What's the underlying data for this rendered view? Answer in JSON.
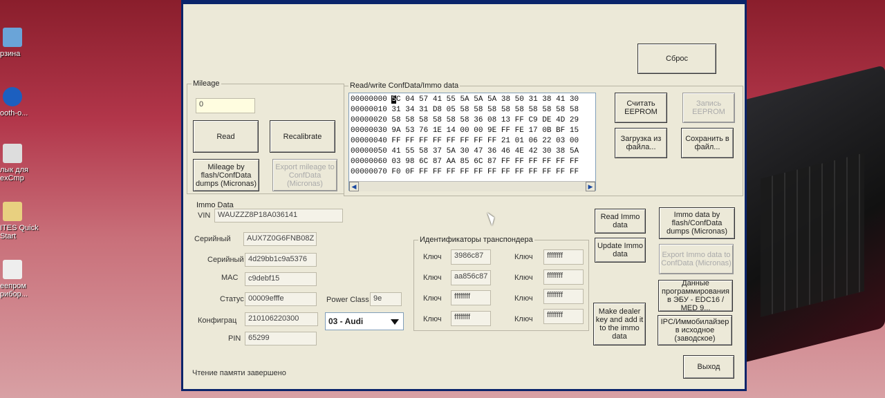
{
  "desktop_icons": [
    {
      "label": "рзина",
      "icon": "recycle-bin-icon"
    },
    {
      "label": "ooth-o...",
      "icon": "bluetooth-icon"
    },
    {
      "label": "лык для exCmp",
      "icon": "shortcut-icon"
    },
    {
      "label": "ITES Quick Start",
      "icon": "app-icon"
    },
    {
      "label": "еепром рибор...",
      "icon": "document-icon"
    }
  ],
  "reset_button": "Сброс",
  "mileage": {
    "group_label": "Mileage",
    "value": "0",
    "read_button": "Read",
    "recalibrate_button": "Recalibrate",
    "by_flash_button": "Mileage by flash/ConfData dumps (Micronas)",
    "export_button": "Export mileage to ConfData (Micronas)"
  },
  "readwrite": {
    "group_label": "Read/write ConfData/Immo data",
    "rows": [
      "00000000 5C 04 57 41 55 5A 5A 5A 38 50 31 38 41 30",
      "00000010 31 34 31 D8 05 58 58 58 58 58 58 58 58 58",
      "00000020 58 58 58 58 58 58 36 08 13 FF C9 DE 4D 29",
      "00000030 9A 53 76 1E 14 00 00 9E FF FE 17 0B BF 15",
      "00000040 FF FF FF FF FF FF FF FF 21 01 06 22 03 00",
      "00000050 41 55 58 37 5A 30 47 36 46 4E 42 30 38 5A",
      "00000060 03 98 6C 87 AA 85 6C 87 FF FF FF FF FF FF",
      "00000070 F0 0F FF FF FF FF FF FF FF FF FF FF FF FF"
    ],
    "read_eeprom": "Считать EEPROM",
    "write_eeprom": "Запись EEPROM",
    "load_file": "Загрузка из файла...",
    "save_file": "Сохранить в файл..."
  },
  "immo": {
    "group_label": "Immo Data",
    "vin_label": "VIN",
    "vin": "WAUZZZ8P18A036141",
    "serial1_label": "Серийный",
    "serial1": "AUX7Z0G6FNB08Z",
    "serial2_label": "Серийный",
    "serial2": "4d29bb1c9a5376",
    "mac_label": "MAC",
    "mac": "c9debf15",
    "status_label": "Статус",
    "status": "00009efffe",
    "config_label": "Конфиграц",
    "config": "210106220300",
    "pin_label": "PIN",
    "pin": "65299",
    "power_class_label": "Power Class",
    "power_class": "9e",
    "model_select": "03 - Audi",
    "read_immo_button": "Read Immo data",
    "update_immo_button": "Update Immo data",
    "make_dealer_button": "Make dealer key and add it to the immo data",
    "immo_by_flash_button": "Immo data by flash/ConfData dumps (Micronas)",
    "export_immo_button": "Export Immo data to ConfData (Micronas)",
    "ecu_data_button": "Данные программирования в ЭБУ - EDC16 / MED 9...",
    "ipc_reset_button": "IPC/Иммобилайзер в исходное (заводское)"
  },
  "transponder": {
    "group_label": "Идентификаторы транспондера",
    "key_label": "Ключ",
    "left": [
      "3986c87",
      "aa856c87",
      "ffffffff",
      "ffffffff"
    ],
    "right": [
      "ffffffff",
      "ffffffff",
      "ffffffff",
      "ffffffff"
    ]
  },
  "exit_button": "Выход",
  "status_text": "Чтение памяти завершено"
}
